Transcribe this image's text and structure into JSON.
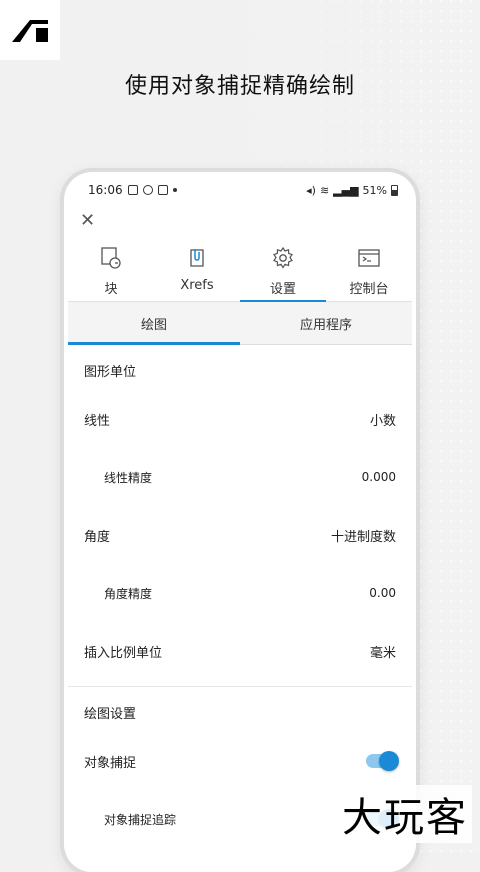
{
  "headline": "使用对象捕捉精确绘制",
  "status_bar": {
    "time": "16:06",
    "battery": "51%"
  },
  "tabs": [
    {
      "label": "块",
      "icon": "block-icon"
    },
    {
      "label": "Xrefs",
      "icon": "xref-icon"
    },
    {
      "label": "设置",
      "icon": "gear-icon"
    },
    {
      "label": "控制台",
      "icon": "console-icon"
    }
  ],
  "active_tab": "设置",
  "subtabs": {
    "drawing": "绘图",
    "application": "应用程序"
  },
  "active_subtab": "绘图",
  "units_section": {
    "title": "图形单位",
    "linear_label": "线性",
    "linear_value": "小数",
    "linear_precision_label": "线性精度",
    "linear_precision_value": "0.000",
    "angle_label": "角度",
    "angle_value": "十进制度数",
    "angle_precision_label": "角度精度",
    "angle_precision_value": "0.00",
    "insert_units_label": "插入比例单位",
    "insert_units_value": "毫米"
  },
  "drawing_section": {
    "title": "绘图设置",
    "osnap_label": "对象捕捉",
    "osnap_on": true,
    "otrack_label": "对象捕捉追踪",
    "otrack_on": true
  },
  "watermark": "大玩客",
  "colors": {
    "accent": "#1a8ad6",
    "toggle_track": "#8cc8ee"
  }
}
